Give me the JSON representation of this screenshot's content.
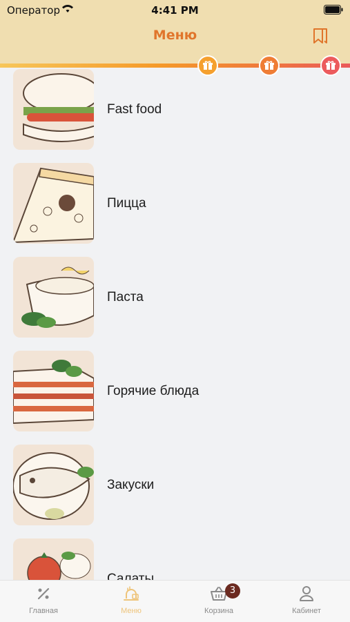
{
  "status_bar": {
    "carrier": "Оператор",
    "time": "4:41 PM"
  },
  "header": {
    "title": "Меню"
  },
  "progress": {
    "fill_fraction": 1.0,
    "gift_markers": 3
  },
  "menu": {
    "items": [
      {
        "label": "Fast food",
        "image": "burger"
      },
      {
        "label": "Пицца",
        "image": "pizza"
      },
      {
        "label": "Паста",
        "image": "pasta"
      },
      {
        "label": "Горячие блюда",
        "image": "lasagna"
      },
      {
        "label": "Закуски",
        "image": "fish"
      },
      {
        "label": "Салаты",
        "image": "salad"
      }
    ]
  },
  "tabbar": {
    "tabs": [
      {
        "label": "Главная",
        "icon": "percent-icon"
      },
      {
        "label": "Меню",
        "icon": "dish-icon"
      },
      {
        "label": "Корзина",
        "icon": "basket-icon",
        "badge": "3"
      },
      {
        "label": "Кабинет",
        "icon": "person-icon"
      }
    ]
  },
  "colors": {
    "accent": "#e0752b",
    "header_bg": "#f0deb0",
    "badge": "#6b2a20"
  }
}
